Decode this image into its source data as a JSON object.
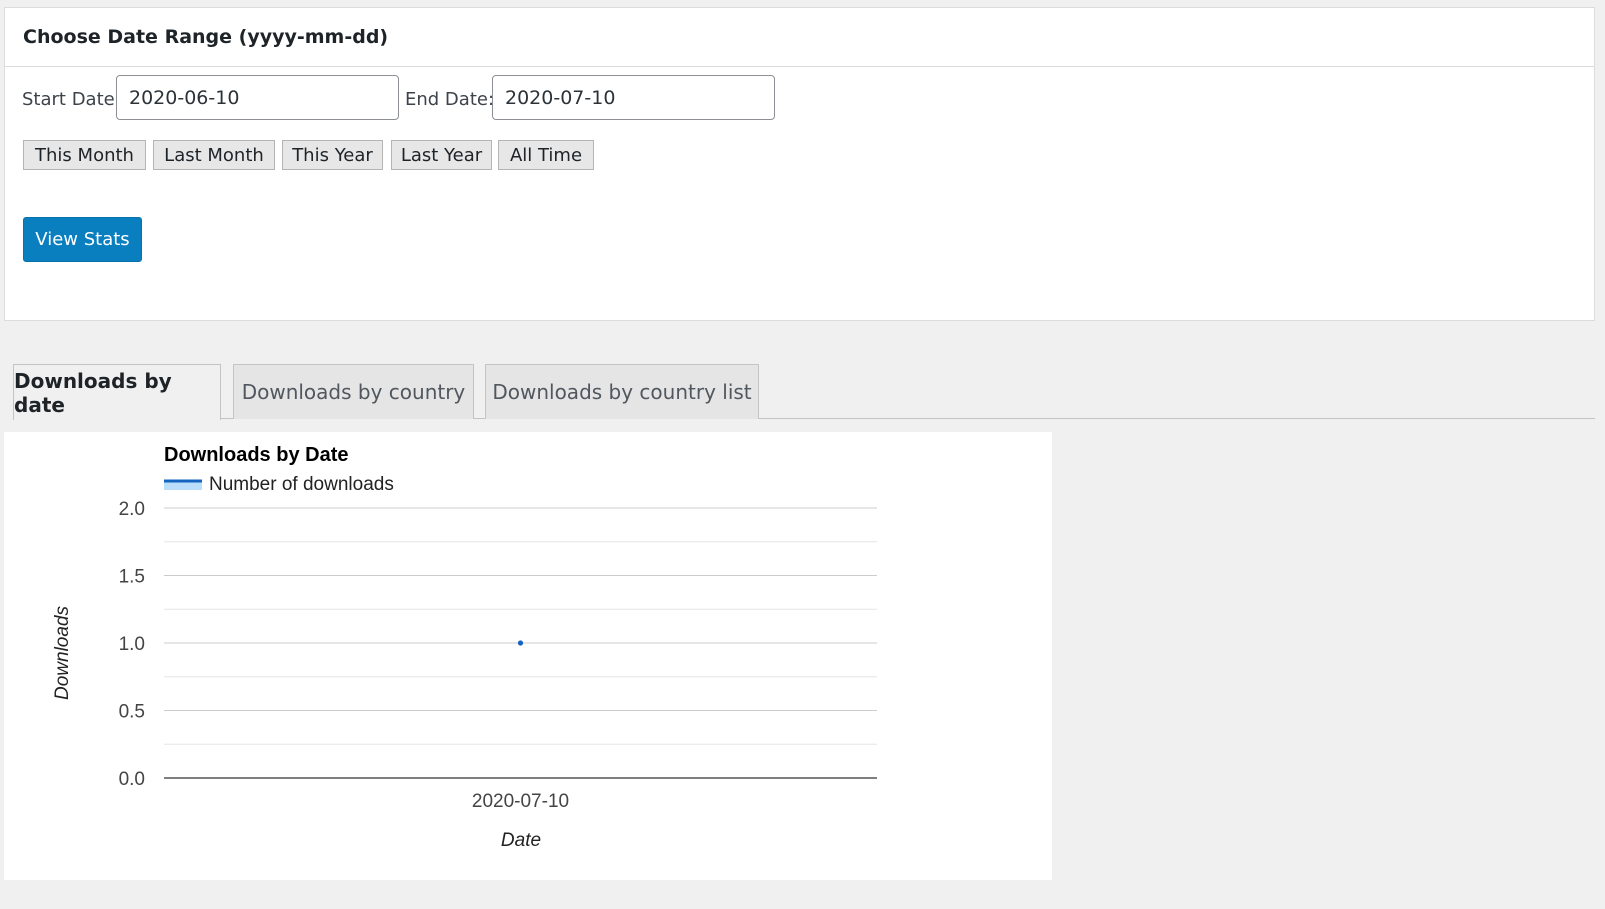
{
  "date_range": {
    "title": "Choose Date Range (yyyy-mm-dd)",
    "start_label": "Start Date:",
    "start_value": "2020-06-10",
    "end_label": "End Date:",
    "end_value": "2020-07-10",
    "presets": [
      "This Month",
      "Last Month",
      "This Year",
      "Last Year",
      "All Time"
    ],
    "submit_label": "View Stats"
  },
  "tabs": [
    {
      "label": "Downloads by date",
      "active": true
    },
    {
      "label": "Downloads by country",
      "active": false
    },
    {
      "label": "Downloads by country list",
      "active": false
    }
  ],
  "colors": {
    "accent": "#0a7fc0",
    "series_line": "#1565c0",
    "series_fill": "#bbdefb"
  },
  "chart_data": {
    "type": "line",
    "title": "Downloads by Date",
    "xlabel": "Date",
    "ylabel": "Downloads",
    "legend_position": "top-left",
    "grid": true,
    "ylim": [
      0,
      2
    ],
    "yticks": [
      "2.0",
      "1.5",
      "1.0",
      "0.5",
      "0.0"
    ],
    "categories": [
      "2020-07-10"
    ],
    "series": [
      {
        "name": "Number of downloads",
        "values": [
          1
        ]
      }
    ]
  }
}
